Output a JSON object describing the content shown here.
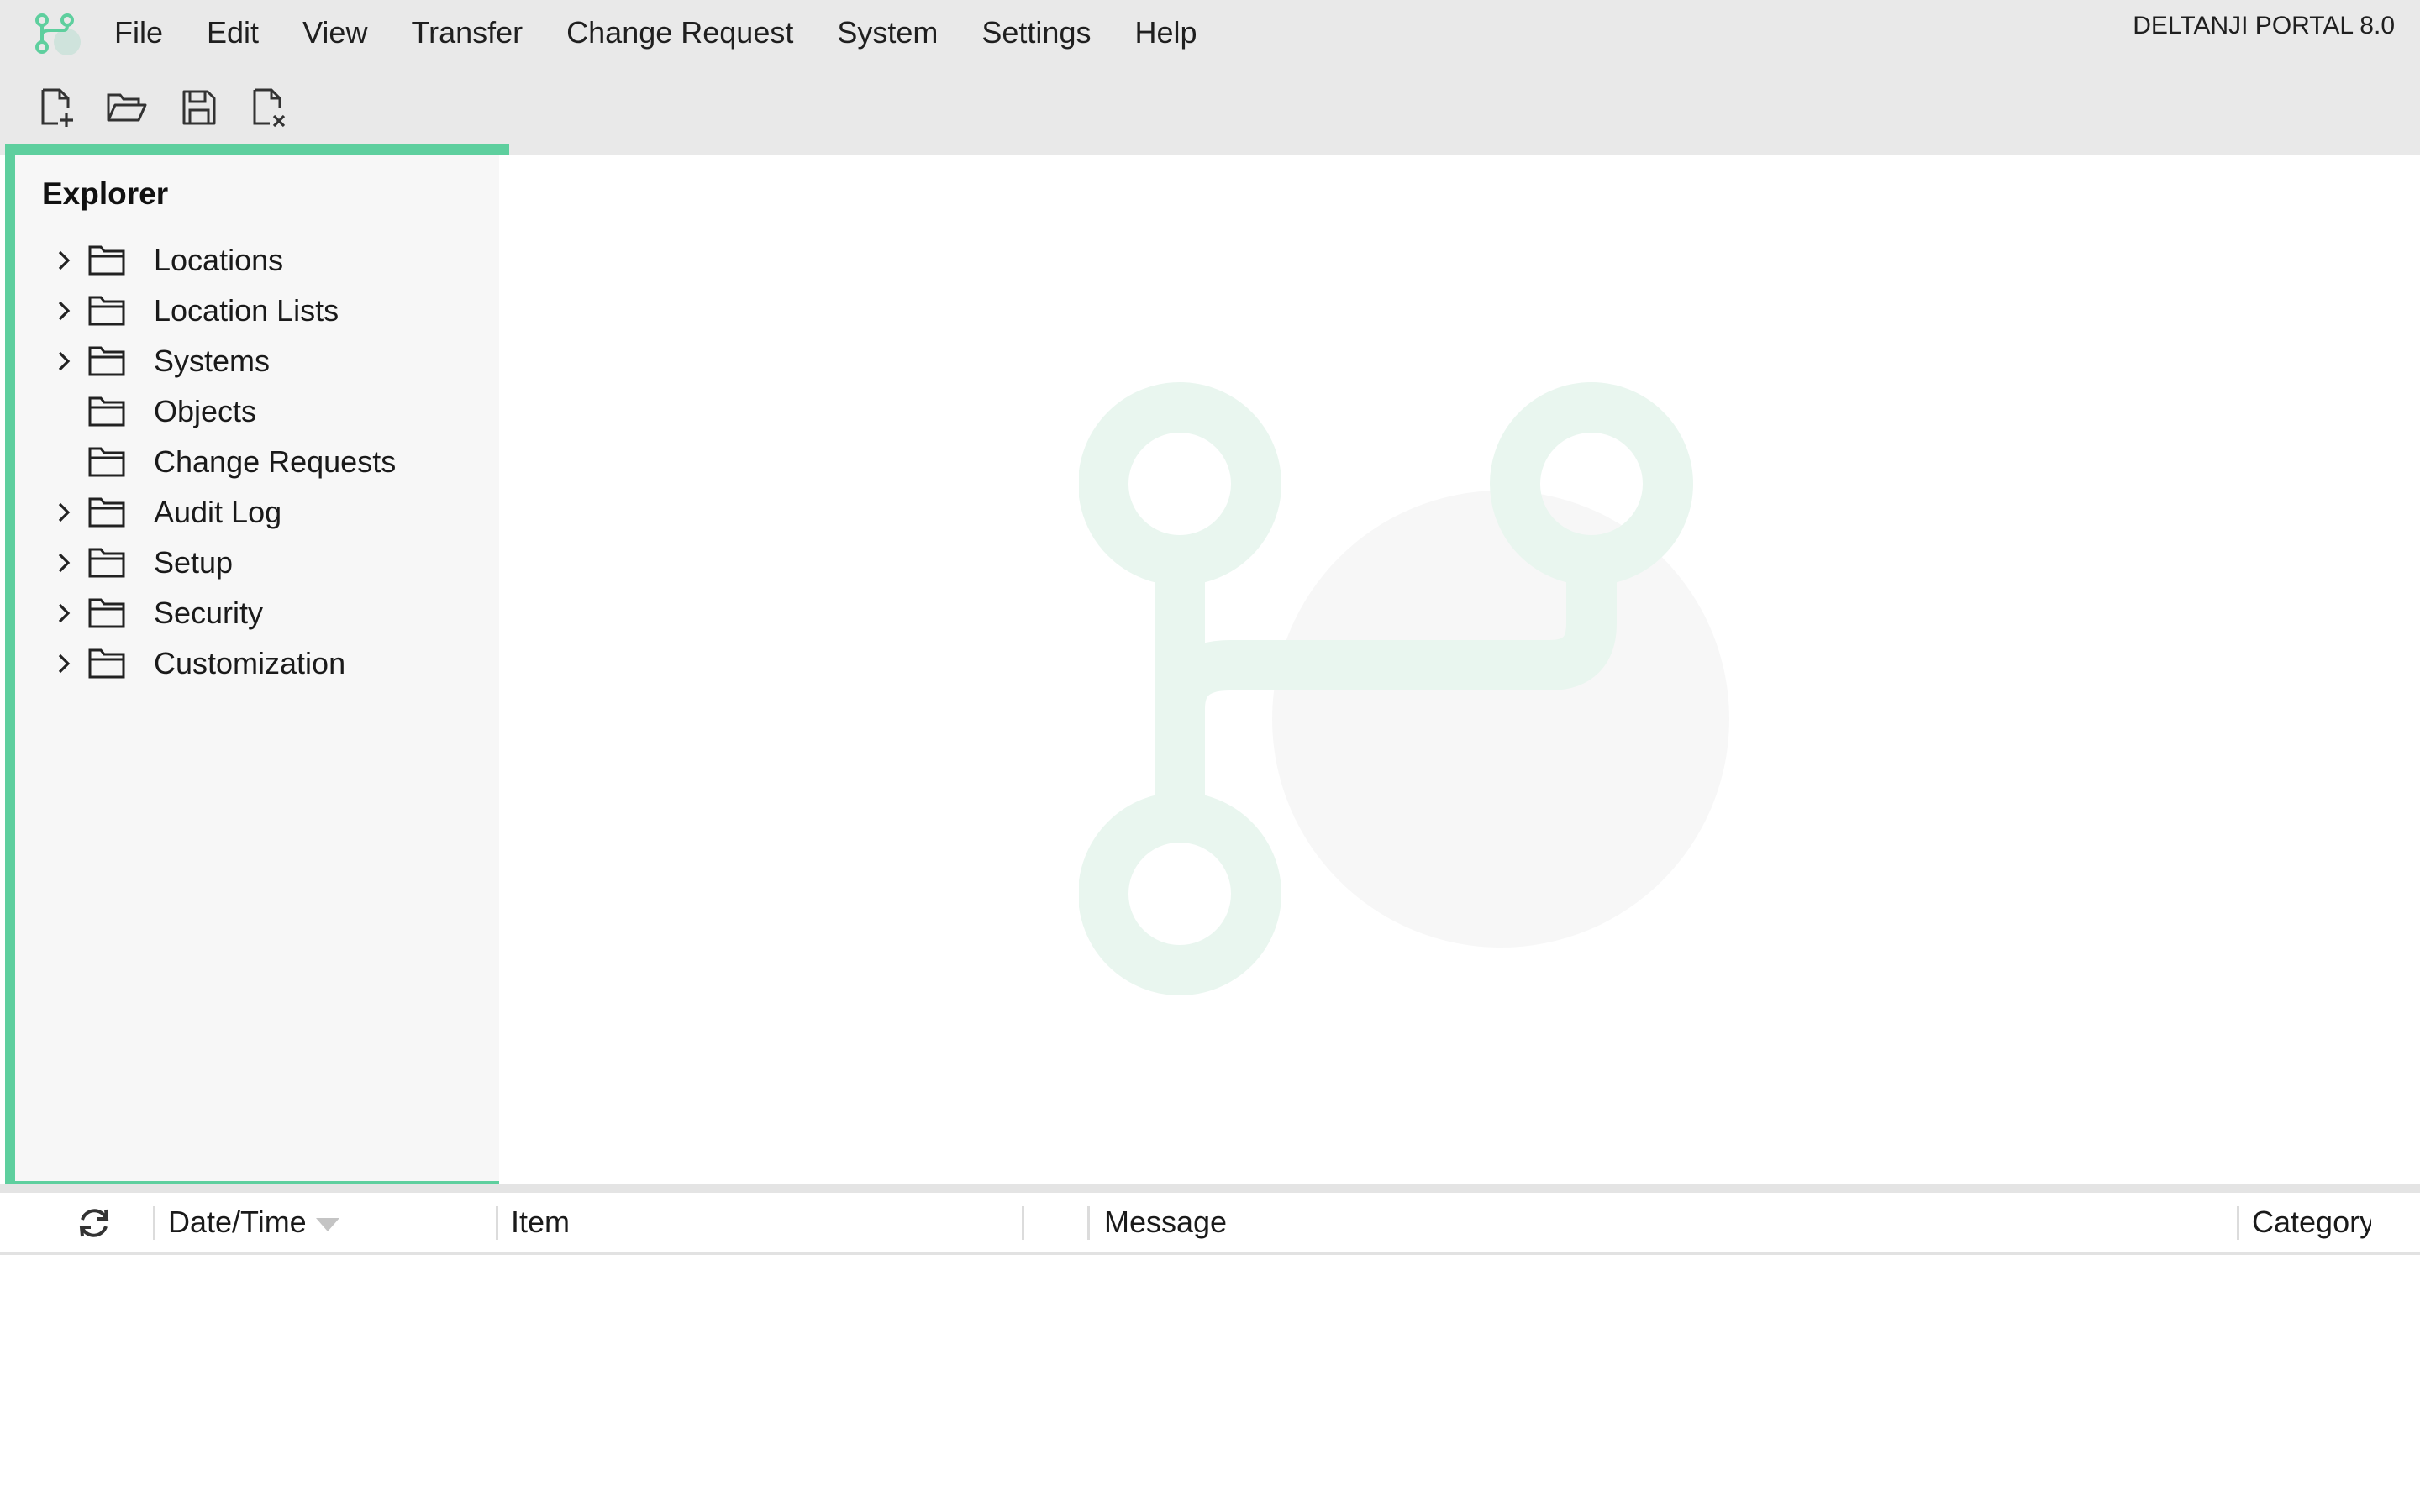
{
  "menubar": {
    "items": [
      "File",
      "Edit",
      "View",
      "Transfer",
      "Change Request",
      "System",
      "Settings",
      "Help"
    ],
    "product_name": "DELTANJI PORTAL 8.0"
  },
  "toolbar": {
    "buttons": [
      {
        "icon": "new-file-icon"
      },
      {
        "icon": "open-folder-icon"
      },
      {
        "icon": "save-icon"
      },
      {
        "icon": "close-file-icon"
      }
    ]
  },
  "explorer": {
    "title": "Explorer",
    "items": [
      {
        "label": "Locations",
        "expandable": true
      },
      {
        "label": "Location Lists",
        "expandable": true
      },
      {
        "label": "Systems",
        "expandable": true
      },
      {
        "label": "Objects",
        "expandable": false
      },
      {
        "label": "Change Requests",
        "expandable": false
      },
      {
        "label": "Audit Log",
        "expandable": true
      },
      {
        "label": "Setup",
        "expandable": true
      },
      {
        "label": "Security",
        "expandable": true
      },
      {
        "label": "Customization",
        "expandable": true
      }
    ]
  },
  "log": {
    "columns": {
      "datetime": "Date/Time",
      "item": "Item",
      "message": "Message",
      "category": "Category"
    }
  },
  "colors": {
    "accent": "#5ecf9e",
    "menubar_bg": "#e9e9e9",
    "watermark": "#e9f6ef"
  }
}
